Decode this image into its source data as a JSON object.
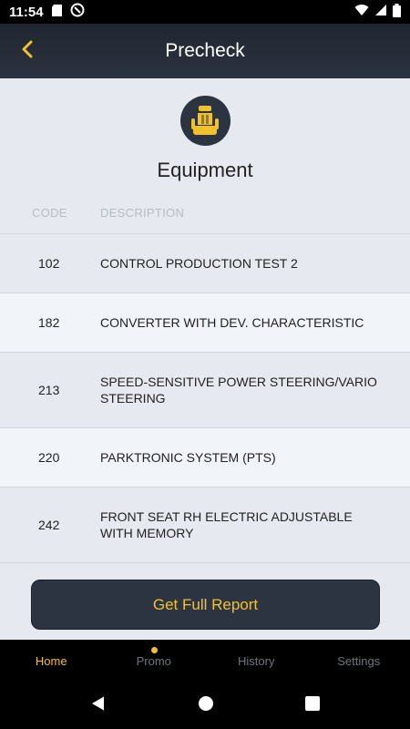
{
  "status_bar": {
    "time": "11:54",
    "left_icons": [
      "sd-card-icon",
      "vpn-icon"
    ],
    "right_icons": [
      "wifi-icon",
      "signal-icon",
      "battery-icon"
    ]
  },
  "app_bar": {
    "title": "Precheck",
    "back_icon": "chevron-left-icon"
  },
  "section": {
    "icon": "car-seat-icon",
    "title": "Equipment"
  },
  "table": {
    "headers": {
      "code": "CODE",
      "description": "DESCRIPTION"
    },
    "rows": [
      {
        "code": "102",
        "description": "CONTROL PRODUCTION TEST 2"
      },
      {
        "code": "182",
        "description": "CONVERTER WITH DEV. CHARACTERISTIC"
      },
      {
        "code": "213",
        "description": "SPEED-SENSITIVE POWER STEERING/VARIO STEERING"
      },
      {
        "code": "220",
        "description": "PARKTRONIC SYSTEM (PTS)"
      },
      {
        "code": "242",
        "description": "FRONT SEAT RH ELECTRIC ADJUSTABLE WITH MEMORY"
      }
    ]
  },
  "report_button": {
    "label": "Get Full Report"
  },
  "bottom_nav": {
    "items": [
      {
        "label": "Home",
        "active": true
      },
      {
        "label": "Promo",
        "has_badge": true
      },
      {
        "label": "History"
      },
      {
        "label": "Settings"
      }
    ]
  },
  "system_nav": [
    "back-triangle-icon",
    "home-circle-icon",
    "recents-square-icon"
  ],
  "colors": {
    "accent": "#f2c12e",
    "dark": "#2c3442",
    "background": "#e6e9ef",
    "row_alt": "#f1f4f9"
  }
}
